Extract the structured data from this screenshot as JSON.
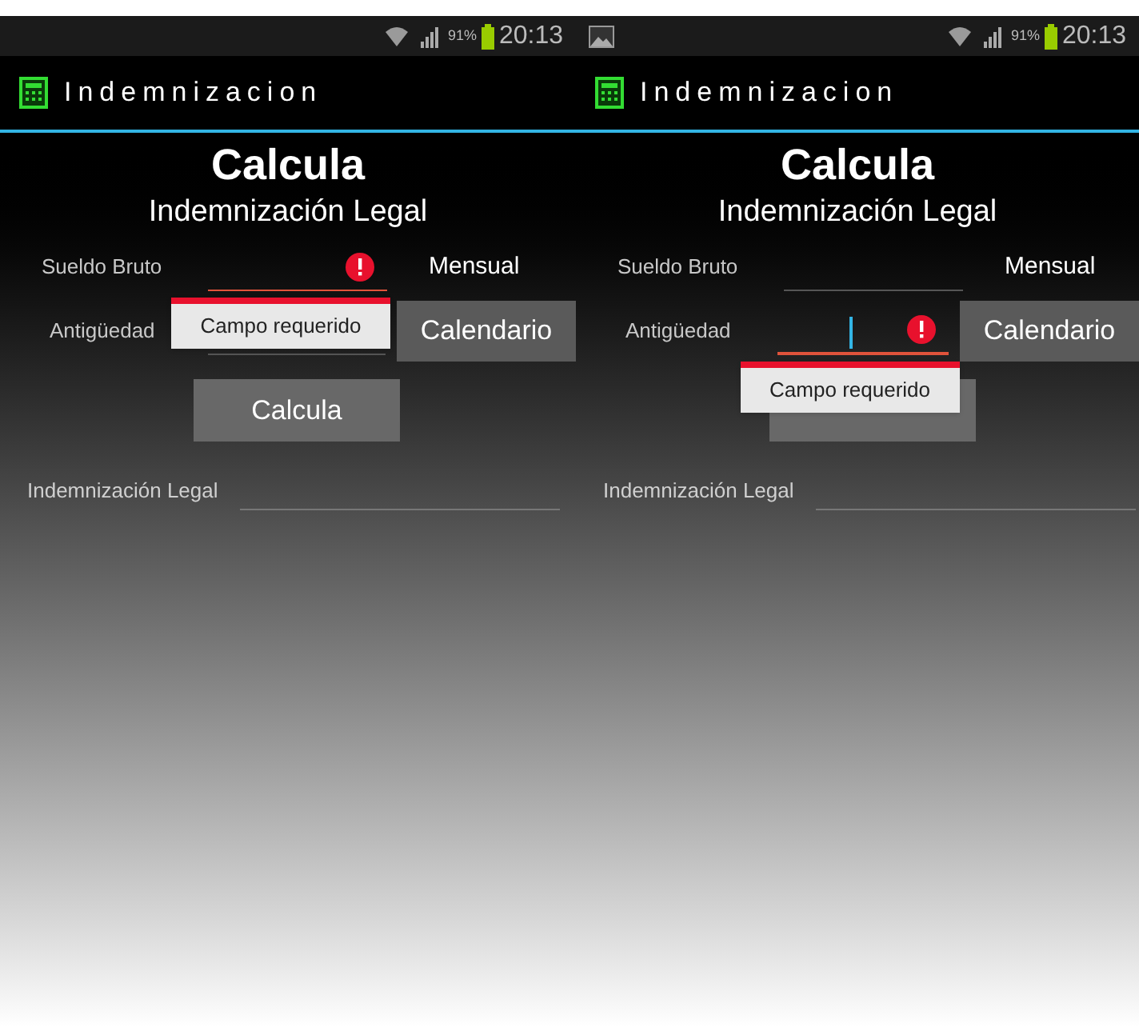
{
  "screens": [
    {
      "status_bar": {
        "notification_icon": false,
        "battery": "91%",
        "time": "20:13"
      },
      "app_bar": {
        "title": "Indemnizacion"
      },
      "heading": "Calcula",
      "subheading": "Indemnización Legal",
      "fields": [
        {
          "label": "Sueldo Bruto",
          "error": true,
          "focused": false,
          "error_message": "Campo requerido"
        },
        {
          "label": "Antigüedad",
          "error": false,
          "focused": false
        }
      ],
      "period_label": "Mensual",
      "calendar_button": "Calendario",
      "calculate_button": {
        "label": "Calcula"
      },
      "result_label": "Indemnización Legal"
    },
    {
      "status_bar": {
        "notification_icon": true,
        "battery": "91%",
        "time": "20:13"
      },
      "app_bar": {
        "title": "Indemnizacion"
      },
      "heading": "Calcula",
      "subheading": "Indemnización Legal",
      "fields": [
        {
          "label": "Sueldo Bruto",
          "error": false,
          "focused": false
        },
        {
          "label": "Antigüedad",
          "error": true,
          "focused": true,
          "error_message": "Campo requerido"
        }
      ],
      "period_label": "Mensual",
      "calendar_button": "Calendario",
      "result_label": "Indemnización Legal"
    }
  ]
}
